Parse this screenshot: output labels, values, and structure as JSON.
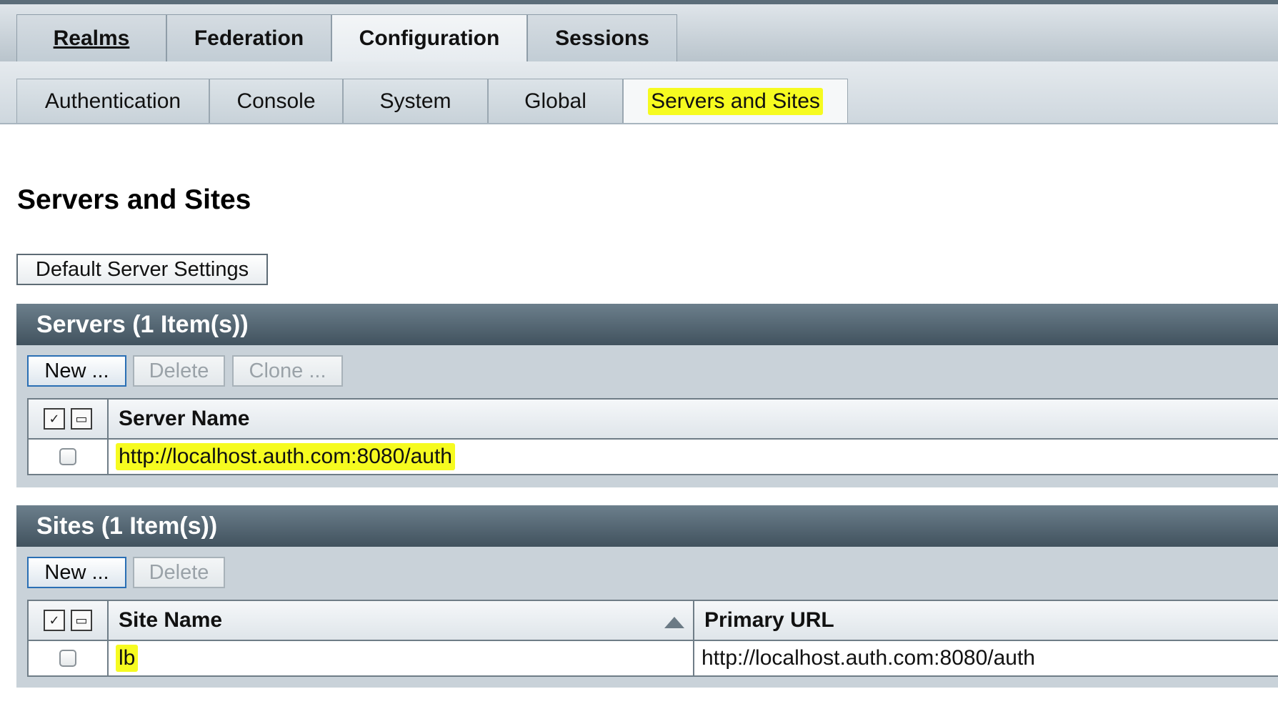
{
  "primary_tabs": [
    {
      "label": "Realms"
    },
    {
      "label": "Federation"
    },
    {
      "label": "Configuration"
    },
    {
      "label": "Sessions"
    }
  ],
  "secondary_tabs": [
    {
      "label": "Authentication"
    },
    {
      "label": "Console"
    },
    {
      "label": "System"
    },
    {
      "label": "Global"
    },
    {
      "label": "Servers and Sites"
    }
  ],
  "page": {
    "title": "Servers and Sites",
    "default_button": "Default Server Settings"
  },
  "servers": {
    "header": "Servers (1 Item(s))",
    "buttons": {
      "new": "New ...",
      "delete": "Delete",
      "clone": "Clone ..."
    },
    "columns": {
      "name": "Server Name"
    },
    "rows": [
      {
        "name": "http://localhost.auth.com:8080/auth"
      }
    ]
  },
  "sites": {
    "header": "Sites (1 Item(s))",
    "buttons": {
      "new": "New ...",
      "delete": "Delete"
    },
    "columns": {
      "name": "Site Name",
      "primary_url": "Primary URL"
    },
    "rows": [
      {
        "name": "lb",
        "primary_url": "http://localhost.auth.com:8080/auth"
      }
    ]
  },
  "icons": {
    "select_all": "select-all-icon",
    "deselect_all": "deselect-all-icon",
    "sort": "sort-ascending-icon"
  },
  "colors": {
    "highlight": "#f6fb20",
    "section_header": "#4a5c68",
    "enabled_button_border": "#2a6fb4"
  }
}
